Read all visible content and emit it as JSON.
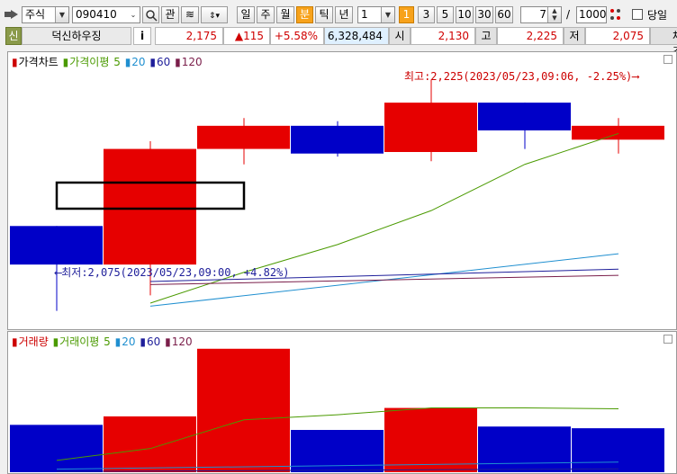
{
  "toolbar": {
    "market_select": "주식",
    "stock_code": "090410",
    "btn_search_label": "",
    "btn_gwan": "관",
    "periods": [
      "일",
      "주",
      "월",
      "분",
      "틱",
      "년"
    ],
    "selected_period": "분",
    "interval_value": "1",
    "quick_intervals": [
      "1",
      "3",
      "5",
      "10",
      "30",
      "60"
    ],
    "selected_interval": "1",
    "count_value": "7",
    "count_sep": "/",
    "max_count": "1000",
    "today_label": "당일"
  },
  "quote": {
    "badge": "신",
    "name": "덕신하우징",
    "info_btn": "i",
    "price": "2,175",
    "change": "▲115",
    "change_pct": "+5.58%",
    "volume": "6,328,484",
    "open_label": "시",
    "open": "2,130",
    "high_label": "고",
    "high": "2,225",
    "low_label": "저",
    "low": "2,075",
    "trade_label": "체결강"
  },
  "price_chart": {
    "legend_title": "가격차트",
    "ma_title": "가격이평",
    "ma_periods": [
      "5",
      "20",
      "60",
      "120"
    ],
    "max_annotation": "최고:2,225(2023/05/23,09:06, -2.25%)",
    "min_annotation": "최저:2,075(2023/05/23,09:00, +4.82%)"
  },
  "volume_chart": {
    "legend_title": "거래량",
    "ma_title": "거래이평",
    "ma_periods": [
      "5",
      "20",
      "60",
      "120"
    ]
  },
  "colors": {
    "up": "#e60000",
    "down": "#0000c8",
    "ma5": "#4a9a00",
    "ma20": "#1f8fd0",
    "ma60": "#1e1e9a",
    "ma120": "#7a1e4a"
  },
  "chart_data": [
    {
      "type": "candlestick",
      "title": "가격차트",
      "candles": [
        {
          "open": 2130,
          "high": 2130,
          "low": 2075,
          "close": 2105
        },
        {
          "open": 2105,
          "high": 2185,
          "low": 2085,
          "close": 2180
        },
        {
          "open": 2180,
          "high": 2200,
          "low": 2170,
          "close": 2195
        },
        {
          "open": 2195,
          "high": 2198,
          "low": 2175,
          "close": 2177
        },
        {
          "open": 2178,
          "high": 2225,
          "low": 2172,
          "close": 2210
        },
        {
          "open": 2210,
          "high": 2210,
          "low": 2180,
          "close": 2192
        },
        {
          "open": 2186,
          "high": 2200,
          "low": 2177,
          "close": 2195
        }
      ],
      "ma": {
        "5": [
          null,
          2080,
          2100,
          2118,
          2140,
          2170,
          2190
        ],
        "20": [
          null,
          2078,
          null,
          null,
          null,
          null,
          2112
        ],
        "60": [
          null,
          2094,
          null,
          null,
          null,
          null,
          2102
        ],
        "120": [
          null,
          2092,
          null,
          null,
          null,
          null,
          2098
        ]
      },
      "ylim": [
        2066,
        2234
      ]
    },
    {
      "type": "bar",
      "title": "거래량",
      "values": [
        280,
        330,
        730,
        250,
        380,
        270,
        260
      ],
      "directions": [
        "down",
        "up",
        "up",
        "down",
        "up",
        "down",
        "down"
      ],
      "ma5": [
        70,
        140,
        310,
        340,
        380,
        380,
        375
      ],
      "ylim": [
        0,
        750
      ]
    }
  ]
}
